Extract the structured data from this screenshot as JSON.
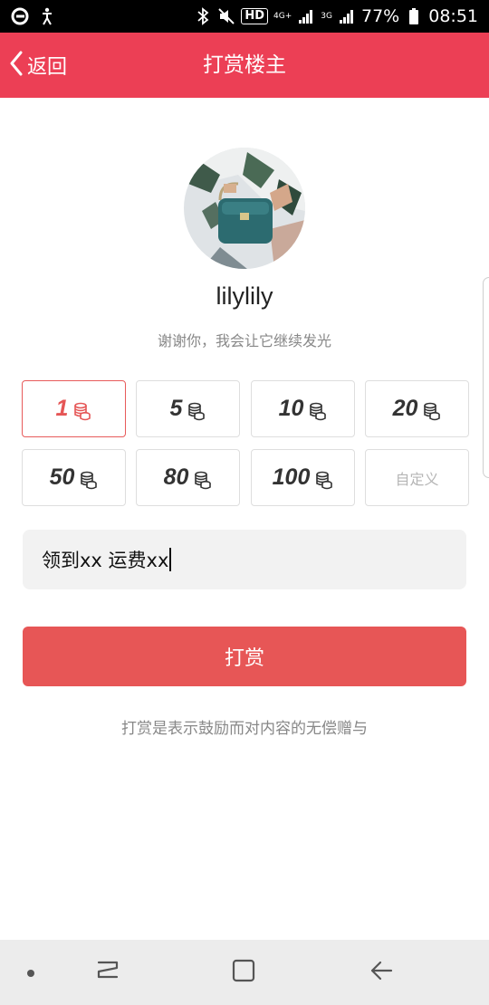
{
  "status_bar": {
    "hd_badge": "HD",
    "network_tag_1": "4G+",
    "network_tag_2": "3G",
    "battery_percent": "77%",
    "time": "08:51",
    "icons": [
      "browser-e-icon",
      "accessibility-icon",
      "bluetooth-icon",
      "mute-icon",
      "signal-icon",
      "battery-icon"
    ]
  },
  "header": {
    "back_label": "返回",
    "title": "打赏楼主",
    "background_color": "#ec3f55"
  },
  "profile": {
    "username": "lilylily",
    "subtitle": "谢谢你，我会让它继续发光"
  },
  "amounts": [
    {
      "value": "1",
      "selected": true
    },
    {
      "value": "5",
      "selected": false
    },
    {
      "value": "10",
      "selected": false
    },
    {
      "value": "20",
      "selected": false
    },
    {
      "value": "50",
      "selected": false
    },
    {
      "value": "80",
      "selected": false
    },
    {
      "value": "100",
      "selected": false
    }
  ],
  "custom_amount_label": "自定义",
  "message": {
    "value": "领到xx 运费xx"
  },
  "submit": {
    "label": "打赏",
    "color": "#e75656"
  },
  "footnote": "打赏是表示鼓励而对内容的无偿赠与"
}
